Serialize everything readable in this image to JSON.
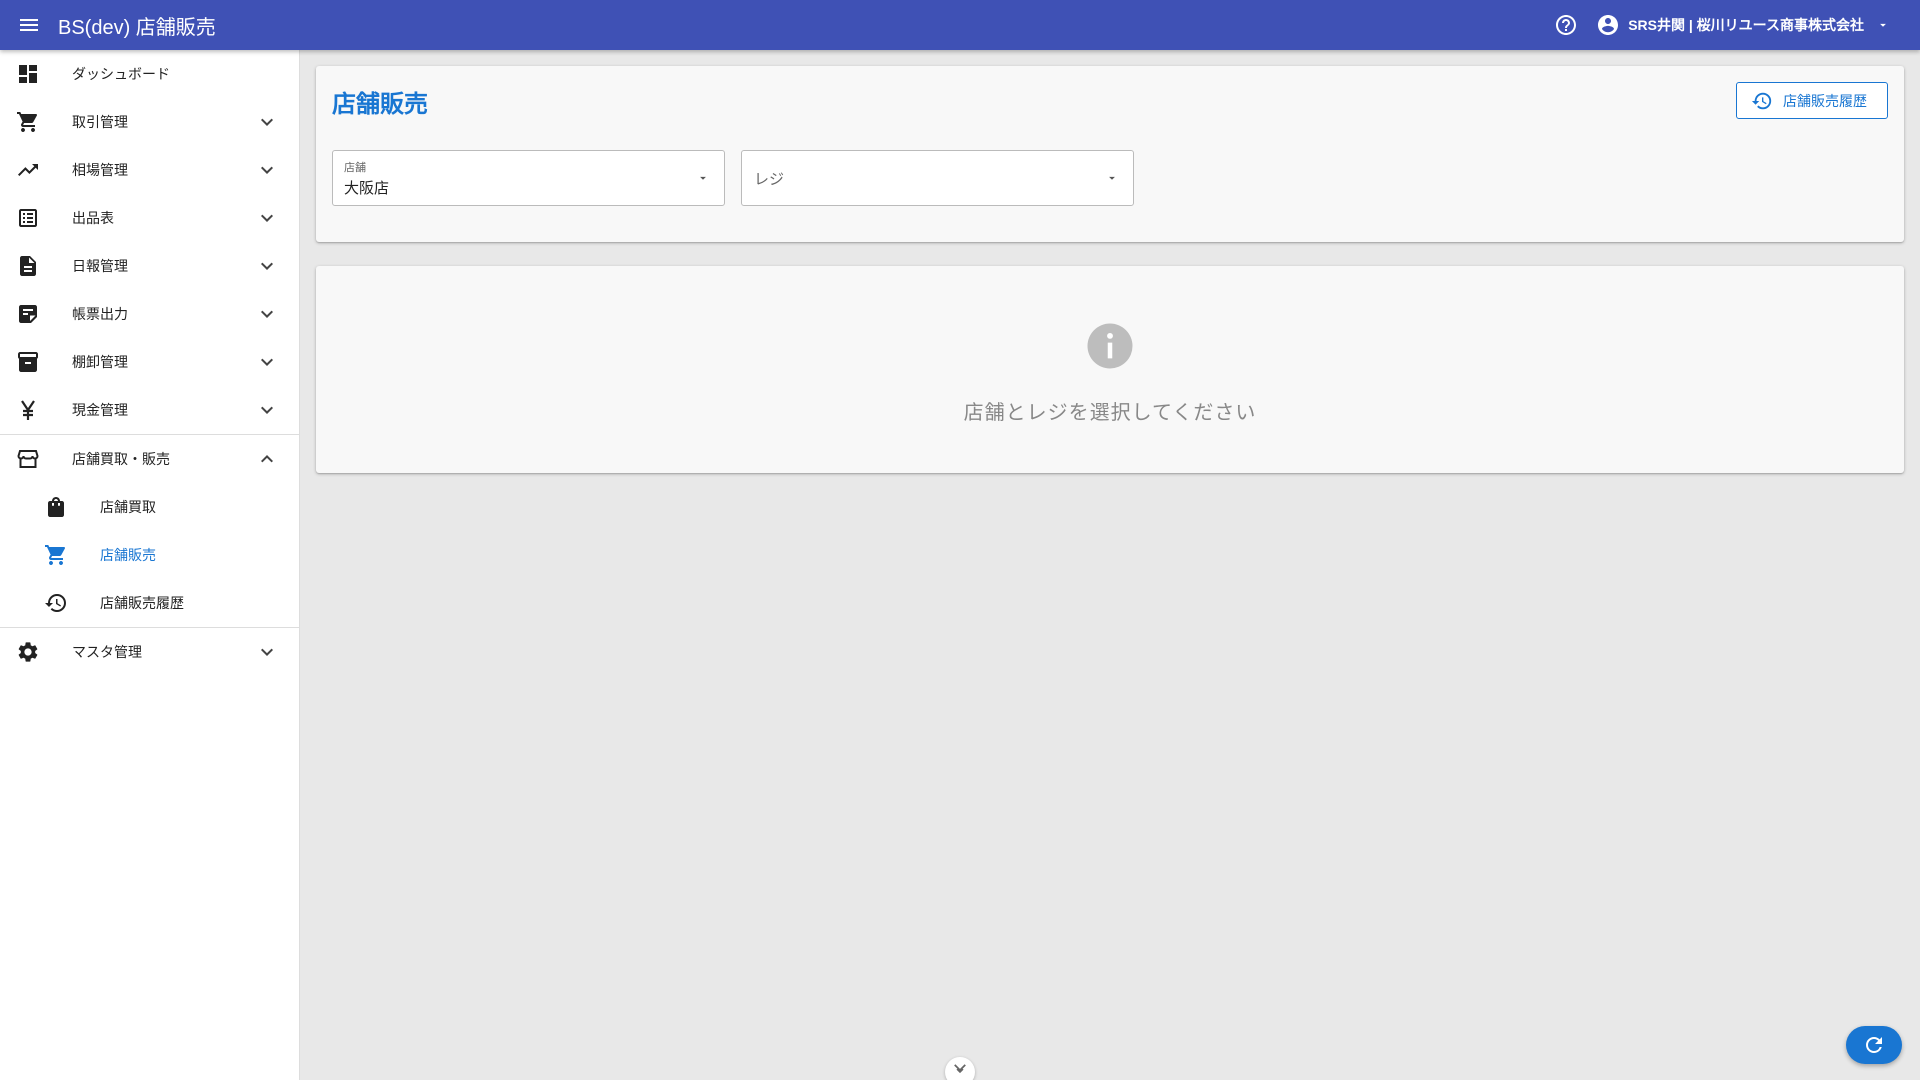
{
  "app": {
    "title": "BS(dev) 店舗販売",
    "menu_icon": "menu-icon",
    "help_icon": "help-circle-icon",
    "account_icon": "account-circle-icon",
    "account_name": "SRS井関 | 桜川リユース商事株式会社",
    "colors": {
      "appbar": "#3f51b5",
      "accent": "#1976d2"
    }
  },
  "sidebar": {
    "items": [
      {
        "label": "ダッシュボード",
        "icon": "dashboard-icon",
        "expandable": false
      },
      {
        "label": "取引管理",
        "icon": "cart-icon",
        "expandable": true
      },
      {
        "label": "相場管理",
        "icon": "trending-up-icon",
        "expandable": true
      },
      {
        "label": "出品表",
        "icon": "list-icon",
        "expandable": true
      },
      {
        "label": "日報管理",
        "icon": "document-icon",
        "expandable": true
      },
      {
        "label": "帳票出力",
        "icon": "report-icon",
        "expandable": true
      },
      {
        "label": "棚卸管理",
        "icon": "archive-icon",
        "expandable": true
      },
      {
        "label": "現金管理",
        "icon": "yen-icon",
        "expandable": true
      },
      {
        "label": "店舗買取・販売",
        "icon": "store-icon",
        "expandable": true,
        "expanded": true
      },
      {
        "label": "マスタ管理",
        "icon": "gear-icon",
        "expandable": true
      }
    ],
    "subitems": [
      {
        "label": "店舗買取",
        "icon": "shopping-bag-icon",
        "active": false
      },
      {
        "label": "店舗販売",
        "icon": "cart-icon",
        "active": true
      },
      {
        "label": "店舗販売履歴",
        "icon": "history-icon",
        "active": false
      }
    ]
  },
  "main": {
    "title": "店舗販売",
    "history_button": "店舗販売履歴",
    "store_field": {
      "label": "店舗",
      "value": "大阪店"
    },
    "register_field": {
      "placeholder": "レジ",
      "value": ""
    },
    "info_message": "店舗とレジを選択してください"
  },
  "fab": {
    "icon": "refresh-icon"
  },
  "scroll_hint": {
    "icon": "chevron-down-icon"
  }
}
